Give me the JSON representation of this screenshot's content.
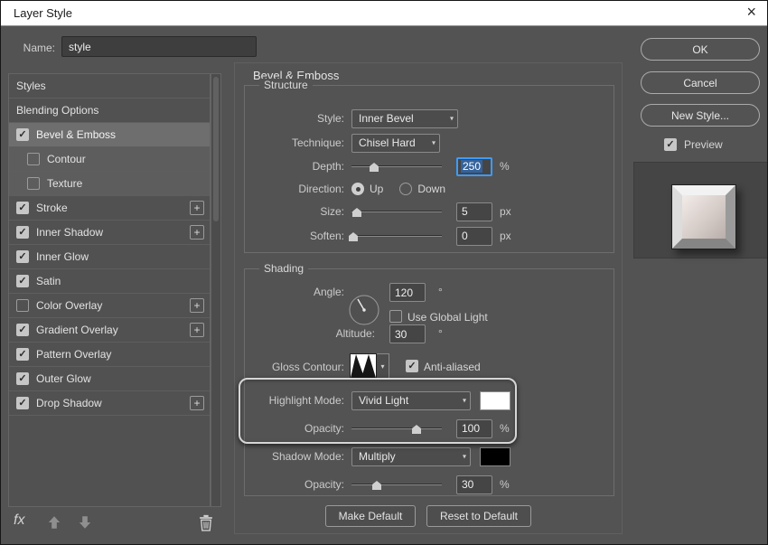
{
  "titlebar": {
    "title": "Layer Style"
  },
  "name_row": {
    "label": "Name:",
    "value": "style"
  },
  "icons": {
    "close": "×",
    "dropdown_arrow": "▾",
    "check": "✓",
    "plus": "+"
  },
  "sidebar": {
    "items": [
      {
        "label": "Styles"
      },
      {
        "label": "Blending Options"
      },
      {
        "label": "Bevel & Emboss",
        "checked": true,
        "selected": true
      },
      {
        "label": "Contour",
        "checked": false,
        "sub": true
      },
      {
        "label": "Texture",
        "checked": false,
        "sub": true
      },
      {
        "label": "Stroke",
        "checked": true,
        "plus": true
      },
      {
        "label": "Inner Shadow",
        "checked": true,
        "plus": true
      },
      {
        "label": "Inner Glow",
        "checked": true
      },
      {
        "label": "Satin",
        "checked": true
      },
      {
        "label": "Color Overlay",
        "checked": false,
        "plus": true
      },
      {
        "label": "Gradient Overlay",
        "checked": true,
        "plus": true
      },
      {
        "label": "Pattern Overlay",
        "checked": true
      },
      {
        "label": "Outer Glow",
        "checked": true
      },
      {
        "label": "Drop Shadow",
        "checked": true,
        "plus": true
      }
    ],
    "fx_label": "fx"
  },
  "panel": {
    "title": "Bevel & Emboss",
    "structure": {
      "legend": "Structure",
      "style": {
        "label": "Style:",
        "value": "Inner Bevel"
      },
      "technique": {
        "label": "Technique:",
        "value": "Chisel Hard"
      },
      "depth": {
        "label": "Depth:",
        "value": "250",
        "unit": "%"
      },
      "direction": {
        "label": "Direction:",
        "up": "Up",
        "down": "Down"
      },
      "size": {
        "label": "Size:",
        "value": "5",
        "unit": "px"
      },
      "soften": {
        "label": "Soften:",
        "value": "0",
        "unit": "px"
      }
    },
    "shading": {
      "legend": "Shading",
      "angle": {
        "label": "Angle:",
        "value": "120",
        "unit": "°"
      },
      "use_global_light": "Use Global Light",
      "altitude": {
        "label": "Altitude:",
        "value": "30",
        "unit": "°"
      },
      "gloss_contour": {
        "label": "Gloss Contour:",
        "anti_aliased": "Anti-aliased"
      },
      "highlight_mode": {
        "label": "Highlight Mode:",
        "value": "Vivid Light"
      },
      "highlight_opacity": {
        "label": "Opacity:",
        "value": "100",
        "unit": "%"
      },
      "shadow_mode": {
        "label": "Shadow Mode:",
        "value": "Multiply"
      },
      "shadow_opacity": {
        "label": "Opacity:",
        "value": "30",
        "unit": "%"
      }
    },
    "footer": {
      "make_default": "Make Default",
      "reset_default": "Reset to Default"
    }
  },
  "actions": {
    "ok": "OK",
    "cancel": "Cancel",
    "new_style": "New Style...",
    "preview": "Preview"
  },
  "colors": {
    "highlight_swatch": "#ffffff",
    "shadow_swatch": "#000000",
    "focus_blue": "#3e9bf7"
  }
}
